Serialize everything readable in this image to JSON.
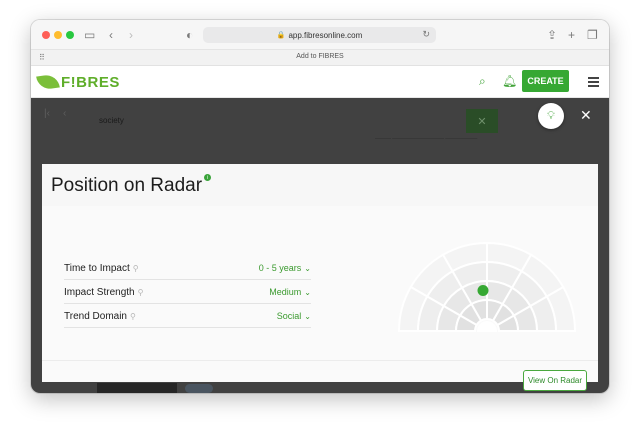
{
  "browser": {
    "url": "app.fibresonline.com",
    "bookmark_label": "Add to FIBRES"
  },
  "app": {
    "logo_text": "F!BRES",
    "create_label": "CREATE"
  },
  "background": {
    "search_term": "society"
  },
  "modal": {
    "title": "Position on Radar",
    "info_glyph": "i",
    "attributes": [
      {
        "label": "Time to Impact",
        "value": "0 - 5 years"
      },
      {
        "label": "Impact Strength",
        "value": "Medium"
      },
      {
        "label": "Trend Domain",
        "value": "Social"
      }
    ],
    "view_button_label": "View On Radar"
  },
  "radar": {
    "rings": 4,
    "sectors": 6,
    "marker_ring_level": 2,
    "marker_sector_fraction": 0.5
  },
  "colors": {
    "brand_green": "#36a833",
    "accent_green": "#3b9a2f",
    "overlay": "#414141"
  },
  "icons": {
    "sidebar": "sidebar-toggle-icon",
    "back": "chevron-left-icon",
    "forward": "chevron-right-icon",
    "privacy": "shield-icon",
    "share": "share-icon",
    "new_tab": "plus-icon",
    "tabs": "tabs-overview-icon",
    "search": "search-icon",
    "bell": "bell-icon",
    "menu": "hamburger-menu-icon",
    "bulb": "lightbulb-icon",
    "close": "close-icon"
  }
}
